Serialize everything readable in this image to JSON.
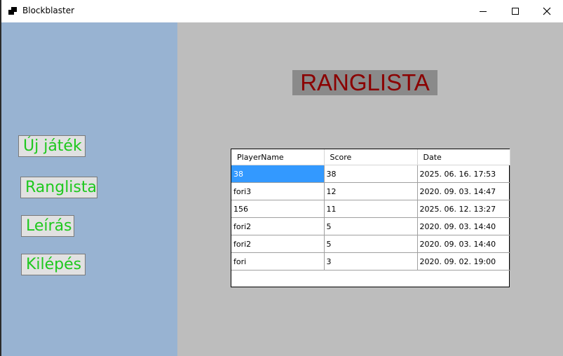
{
  "window": {
    "title": "Blockblaster",
    "icon": "app-window-icon"
  },
  "sidebar": {
    "background": "#98b3d2",
    "buttons": [
      {
        "label": "Új játék"
      },
      {
        "label": "Ranglista"
      },
      {
        "label": "Leírás"
      },
      {
        "label": "Kilépés"
      }
    ],
    "button_text_color": "#1ec81e"
  },
  "main": {
    "title": "RANGLISTA",
    "title_color": "#8b0000",
    "grid": {
      "columns": [
        "PlayerName",
        "Score",
        "Date"
      ],
      "rows": [
        {
          "player": "38",
          "score": "38",
          "date": "2025. 06. 16. 17:53"
        },
        {
          "player": "fori3",
          "score": "12",
          "date": "2020. 09. 03. 14:47"
        },
        {
          "player": "156",
          "score": "11",
          "date": "2025. 06. 12. 13:27"
        },
        {
          "player": "fori2",
          "score": "5",
          "date": "2020. 09. 03. 14:40"
        },
        {
          "player": "fori2",
          "score": "5",
          "date": "2020. 09. 03. 14:40"
        },
        {
          "player": "fori",
          "score": "3",
          "date": "2020. 09. 02. 19:00"
        }
      ],
      "selection_color": "#3399ff"
    }
  }
}
